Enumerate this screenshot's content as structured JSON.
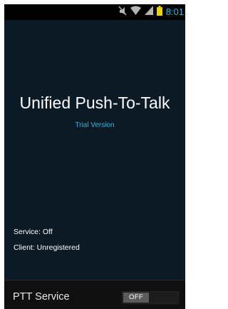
{
  "status_bar": {
    "time": "8:01",
    "icons": [
      "mute-icon",
      "wifi-icon",
      "signal-icon",
      "battery-icon"
    ],
    "time_color": "#33b5e5"
  },
  "main": {
    "title": "Unified Push-To-Talk",
    "subtitle": "Trial Version",
    "subtitle_color": "#33b5e5",
    "service_status": "Service: Off",
    "client_status": "Client: Unregistered"
  },
  "bottom": {
    "ptt_label": "PTT Service",
    "toggle_state": "OFF"
  }
}
